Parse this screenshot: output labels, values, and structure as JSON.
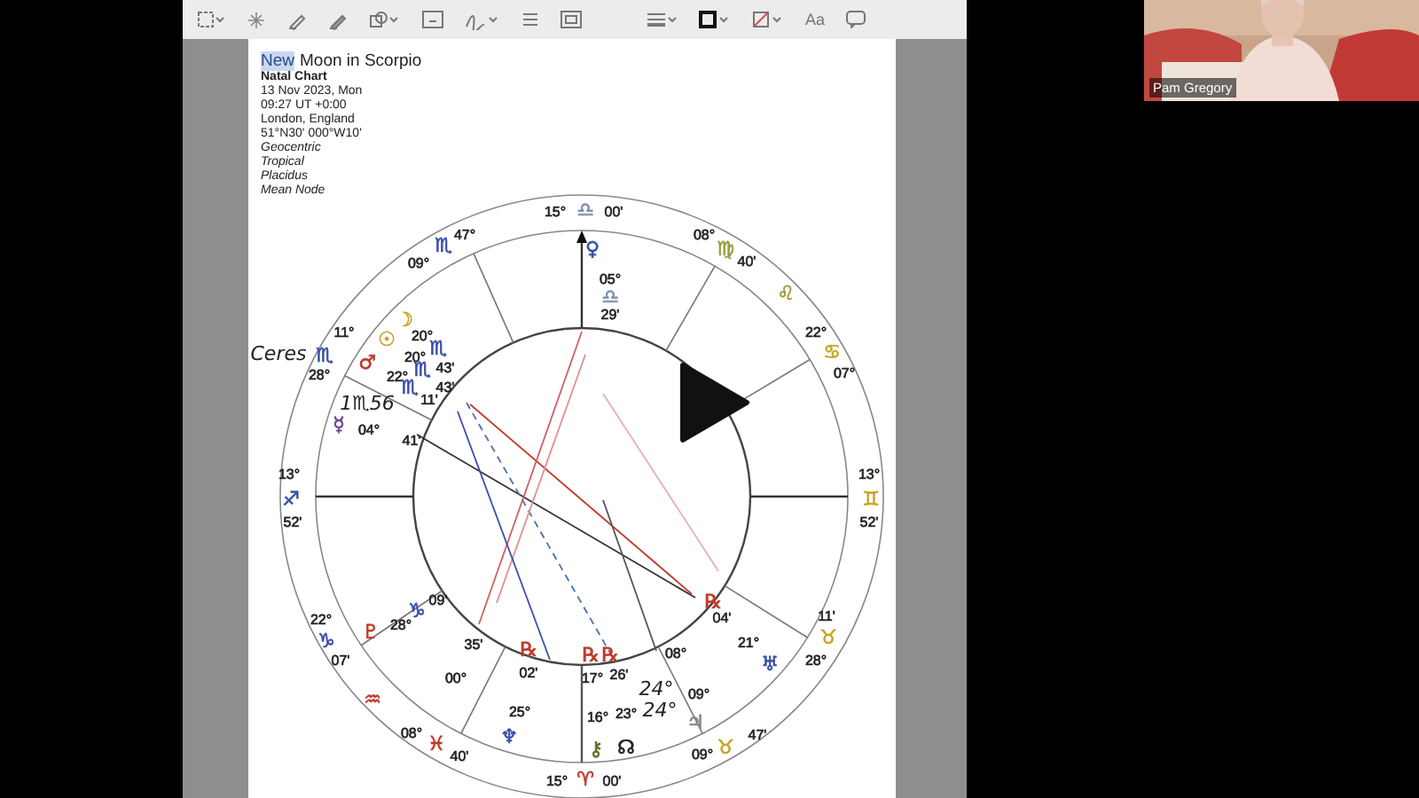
{
  "toolbar": {
    "font_button": "Aa"
  },
  "document": {
    "title_parts": [
      {
        "text": "New",
        "selected": true
      },
      {
        "text": "Moon in Scorpio",
        "selected": false
      }
    ],
    "subtitle": "Natal Chart",
    "lines": [
      {
        "text": "13 Nov 2023, Mon",
        "kind": "plain"
      },
      {
        "text": "09:27  UT +0:00",
        "kind": "plain"
      },
      {
        "text": "London, England",
        "kind": "plain"
      },
      {
        "text": "51°N30' 000°W10'",
        "kind": "plain"
      },
      {
        "text": "Geocentric",
        "kind": "italic"
      },
      {
        "text": "Tropical",
        "kind": "italic"
      },
      {
        "text": "Placidus",
        "kind": "italic"
      },
      {
        "text": "Mean Node",
        "kind": "italic"
      }
    ]
  },
  "chart": {
    "labels": [
      {
        "text": "15°",
        "color": "#222222"
      },
      {
        "text": "♎",
        "color": "#7f8fb0"
      },
      {
        "text": "00'",
        "color": "#222222"
      },
      {
        "text": "09°",
        "color": "#222222"
      },
      {
        "text": "♏",
        "color": "#3a4fa8"
      },
      {
        "text": "47°",
        "color": "#222222"
      },
      {
        "text": "08°",
        "color": "#222222"
      },
      {
        "text": "♍",
        "color": "#9a9a40"
      },
      {
        "text": "40'",
        "color": "#222222"
      },
      {
        "text": "♌",
        "color": "#9a9a40"
      },
      {
        "text": "22°",
        "color": "#222222"
      },
      {
        "text": "♋",
        "color": "#c9a227"
      },
      {
        "text": "07°",
        "color": "#222222"
      },
      {
        "text": "11°",
        "color": "#222222"
      },
      {
        "text": "♏",
        "color": "#3a4fa8"
      },
      {
        "text": "28°",
        "color": "#222222"
      },
      {
        "text": "13°",
        "color": "#222222"
      },
      {
        "text": "♐",
        "color": "#3a4fa8"
      },
      {
        "text": "52'",
        "color": "#222222"
      },
      {
        "text": "13°",
        "color": "#222222"
      },
      {
        "text": "♊",
        "color": "#c9a227"
      },
      {
        "text": "52'",
        "color": "#222222"
      },
      {
        "text": "22°",
        "color": "#222222"
      },
      {
        "text": "♑",
        "color": "#3a4fa8"
      },
      {
        "text": "07'",
        "color": "#222222"
      },
      {
        "text": "♒",
        "color": "#c0392b"
      },
      {
        "text": "08°",
        "color": "#222222"
      },
      {
        "text": "♓",
        "color": "#c0392b"
      },
      {
        "text": "40'",
        "color": "#222222"
      },
      {
        "text": "15°",
        "color": "#222222"
      },
      {
        "text": "♈",
        "color": "#c0392b"
      },
      {
        "text": "00'",
        "color": "#222222"
      },
      {
        "text": "09°",
        "color": "#222222"
      },
      {
        "text": "♉",
        "color": "#c9a227"
      },
      {
        "text": "47'",
        "color": "#222222"
      },
      {
        "text": "11'",
        "color": "#222222"
      },
      {
        "text": "♉",
        "color": "#c9a227"
      },
      {
        "text": "28°",
        "color": "#222222"
      },
      {
        "text": "♀",
        "color": "#3a4fa8"
      },
      {
        "text": "05°",
        "color": "#222222"
      },
      {
        "text": "♎",
        "color": "#7f8fb0"
      },
      {
        "text": "29'",
        "color": "#222222"
      },
      {
        "text": "☽",
        "color": "#c9a227"
      },
      {
        "text": "☉",
        "color": "#c9a227"
      },
      {
        "text": "♂",
        "color": "#c0392b"
      },
      {
        "text": "20°",
        "color": "#222222"
      },
      {
        "text": "20°",
        "color": "#222222"
      },
      {
        "text": "22°",
        "color": "#222222"
      },
      {
        "text": "♏",
        "color": "#3a4fa8"
      },
      {
        "text": "♏",
        "color": "#3a4fa8"
      },
      {
        "text": "♏",
        "color": "#3a4fa8"
      },
      {
        "text": "43'",
        "color": "#222222"
      },
      {
        "text": "43'",
        "color": "#222222"
      },
      {
        "text": "11'",
        "color": "#222222"
      },
      {
        "text": "☿",
        "color": "#6a3d8a"
      },
      {
        "text": "04°",
        "color": "#222222"
      },
      {
        "text": "41'",
        "color": "#222222"
      },
      {
        "text": "♇",
        "color": "#c0392b"
      },
      {
        "text": "28°",
        "color": "#222222"
      },
      {
        "text": "♑",
        "color": "#3a4fa8"
      },
      {
        "text": "09'",
        "color": "#222222"
      },
      {
        "text": "35'",
        "color": "#222222"
      },
      {
        "text": "00°",
        "color": "#222222"
      },
      {
        "text": "℞",
        "color": "#c0392b"
      },
      {
        "text": "02'",
        "color": "#222222"
      },
      {
        "text": "25°",
        "color": "#222222"
      },
      {
        "text": "♆",
        "color": "#3a4fa8"
      },
      {
        "text": "17°",
        "color": "#222222"
      },
      {
        "text": "26'",
        "color": "#222222"
      },
      {
        "text": "16°",
        "color": "#222222"
      },
      {
        "text": "23°",
        "color": "#222222"
      },
      {
        "text": "⚷",
        "color": "#6b6b2a"
      },
      {
        "text": "☊",
        "color": "#222222"
      },
      {
        "text": "08°",
        "color": "#222222"
      },
      {
        "text": "09°",
        "color": "#222222"
      },
      {
        "text": "♃",
        "color": "#888888"
      },
      {
        "text": "04'",
        "color": "#222222"
      },
      {
        "text": "21°",
        "color": "#222222"
      },
      {
        "text": "♅",
        "color": "#3a4fa8"
      },
      {
        "text": "℞",
        "color": "#c0392b"
      },
      {
        "text": "℞",
        "color": "#c0392b"
      },
      {
        "text": "℞",
        "color": "#c0392b"
      }
    ],
    "annotations": [
      {
        "text": "Ceres"
      },
      {
        "text": "1♏56"
      },
      {
        "text": "24°"
      },
      {
        "text": "24°"
      }
    ]
  },
  "webcam": {
    "name": "Pam Gregory"
  }
}
